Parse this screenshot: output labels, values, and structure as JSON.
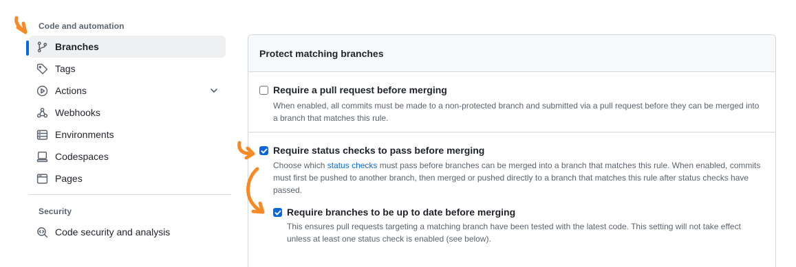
{
  "sidebar": {
    "section_code": "Code and automation",
    "section_security": "Security",
    "items": [
      {
        "label": "Branches",
        "icon": "git-branch-icon",
        "active": true
      },
      {
        "label": "Tags",
        "icon": "tag-icon"
      },
      {
        "label": "Actions",
        "icon": "play-icon",
        "expandable": true
      },
      {
        "label": "Webhooks",
        "icon": "webhook-icon"
      },
      {
        "label": "Environments",
        "icon": "server-icon"
      },
      {
        "label": "Codespaces",
        "icon": "codespaces-icon"
      },
      {
        "label": "Pages",
        "icon": "browser-icon"
      }
    ],
    "security_items": [
      {
        "label": "Code security and analysis",
        "icon": "codescan-icon"
      }
    ]
  },
  "panel": {
    "title": "Protect matching branches",
    "rules": [
      {
        "title": "Require a pull request before merging",
        "checked": false,
        "desc_line1": "When enabled, all commits must be made to a non-protected branch and submitted via a pull request before they can be merged into",
        "desc_line2": "a branch that matches this rule."
      },
      {
        "title": "Require status checks to pass before merging",
        "checked": true,
        "desc_prefix": "Choose which ",
        "desc_link": "status checks",
        "desc_line1_suffix": " must pass before branches can be merged into a branch that matches this rule. When enabled, commits",
        "desc_line2": "must first be pushed to another branch, then merged or pushed directly to a branch that matches this rule after status checks have",
        "desc_line3": "passed."
      },
      {
        "title": "Require branches to be up to date before merging",
        "checked": true,
        "desc_line1": "This ensures pull requests targeting a matching branch have been tested with the latest code. This setting will not take effect",
        "desc_line2": "unless at least one status check is enabled (see below)."
      }
    ]
  },
  "colors": {
    "accent": "#0969da",
    "annotation": "#f58a27",
    "muted_text": "#59636e",
    "border": "#d1d9e0"
  }
}
